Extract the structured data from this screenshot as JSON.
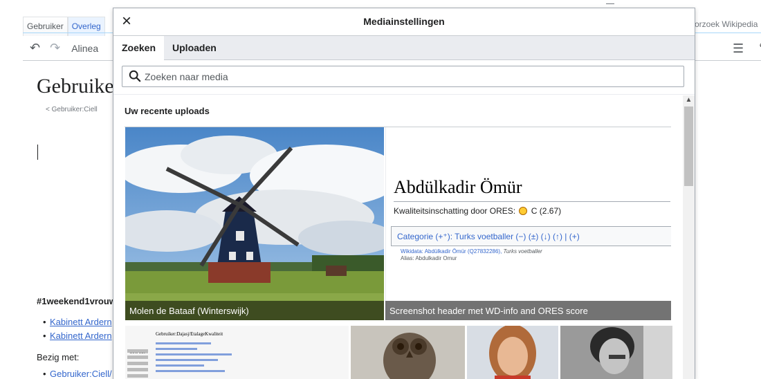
{
  "background_page": {
    "tabs": [
      "Gebruiker",
      "Overleg"
    ],
    "search_partial": "orzoek Wikipedia",
    "toolbar": {
      "paragraph_label": "Alinea"
    },
    "heading": "Gebruike",
    "subtitle": "< Gebruiker:Ciell",
    "hashtag": "#1weekend1vrouw",
    "list_items": [
      "Kabinett Ardern",
      "Kabinett Ardern"
    ],
    "bezig_label": "Bezig met:",
    "bezig_item": "Gebruiker:Ciell/"
  },
  "dialog": {
    "close_symbol": "×",
    "title": "Mediainstellingen",
    "tabs": [
      {
        "label": "Zoeken",
        "active": true
      },
      {
        "label": "Uploaden",
        "active": false
      }
    ],
    "search": {
      "placeholder": "Zoeken naar media",
      "value": ""
    },
    "section_title": "Uw recente uploads",
    "uploads": [
      {
        "caption": "Molen de Bataaf (Winterswijk)",
        "icon": "windmill-photo"
      },
      {
        "caption": "Screenshot header met WD-info and ORES score",
        "icon": "screenshot-image"
      },
      {
        "caption": "",
        "icon": "document-screenshot"
      },
      {
        "caption": "",
        "icon": "owl-sculpture-photo"
      },
      {
        "caption": "",
        "icon": "woman-portrait-photo"
      },
      {
        "caption": "",
        "icon": "bw-portrait-photo"
      }
    ],
    "screenshot_content": {
      "name": "Abdülkadir Ömür",
      "ores_label": "Kwaliteitsinschatting door ORES:",
      "ores_grade": "C",
      "ores_score": "(2.67)",
      "category_line": "Categorie (+⁺):  Turks voetballer (−) (±) (↓) (↑)  |  (+)",
      "wikidata_prefix": "Wikidata:",
      "wikidata_link": "Abdülkadir Ömür (Q27832286)",
      "wikidata_desc": "Turks voetballer",
      "alias_line": "Alias: Abdulkadir Omur"
    },
    "doc_content": {
      "header": "Gebruiker:Dajasj/EtalageKwaliteit",
      "logo_text": "WIKIPEDIA"
    }
  },
  "colors": {
    "link": "#3366cc",
    "border": "#a2a9b1",
    "tab_bar": "#eaecf0",
    "ores_badge": "#ffcc33"
  }
}
